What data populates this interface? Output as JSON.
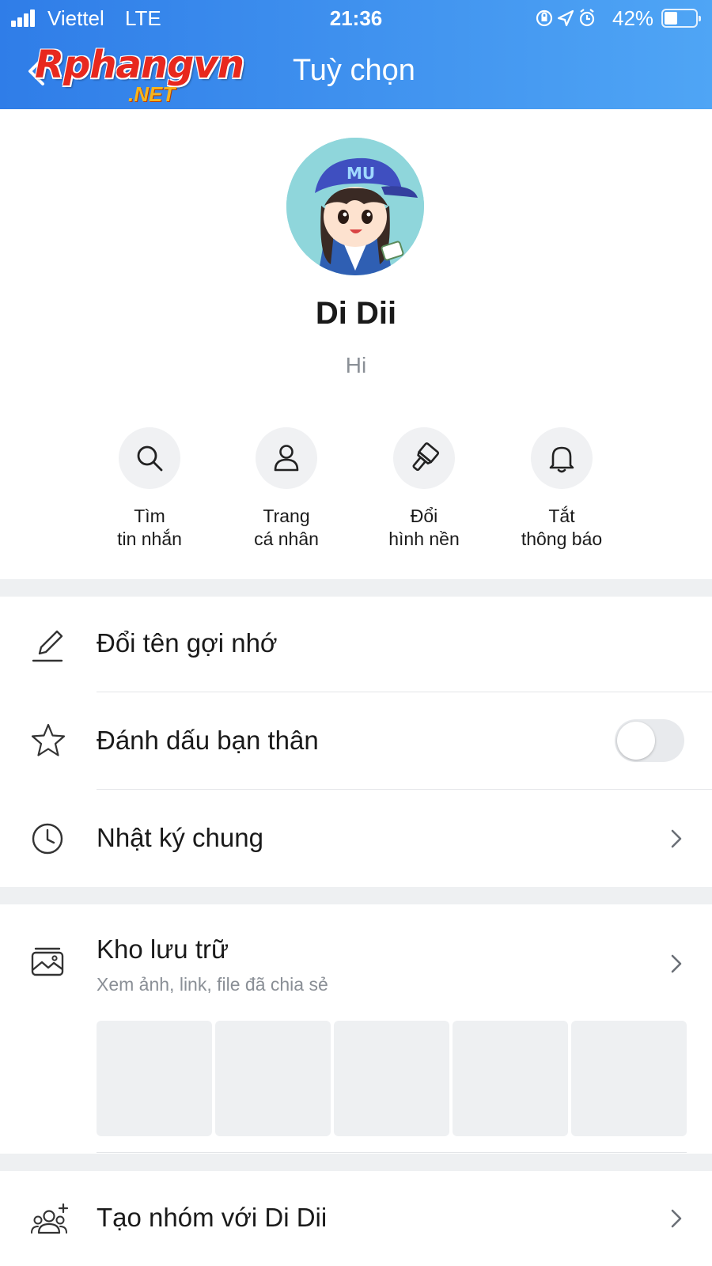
{
  "status_bar": {
    "carrier": "Viettel",
    "network": "LTE",
    "time": "21:36",
    "battery_percent": "42%",
    "battery_level": 0.42
  },
  "header": {
    "logo_text": "Rphangvn",
    "logo_suffix": ".NET",
    "title": "Tuỳ chọn"
  },
  "profile": {
    "name": "Di Dii",
    "status": "Hi"
  },
  "quick_actions": [
    {
      "icon": "search-icon",
      "line1": "Tìm",
      "line2": "tin nhắn"
    },
    {
      "icon": "person-icon",
      "line1": "Trang",
      "line2": "cá nhân"
    },
    {
      "icon": "paintbrush-icon",
      "line1": "Đổi",
      "line2": "hình nền"
    },
    {
      "icon": "bell-icon",
      "line1": "Tắt",
      "line2": "thông báo"
    }
  ],
  "options": {
    "rename": {
      "label": "Đổi tên gợi nhớ",
      "icon": "pencil-icon"
    },
    "best_friend": {
      "label": "Đánh dấu bạn thân",
      "icon": "star-icon",
      "toggle_on": false
    },
    "shared_timeline": {
      "label": "Nhật ký chung",
      "icon": "clock-icon"
    },
    "storage": {
      "label": "Kho lưu trữ",
      "sublabel": "Xem ảnh, link, file đã chia sẻ",
      "icon": "photo-folder-icon"
    },
    "create_group": {
      "label": "Tạo nhóm với Di Dii",
      "icon": "add-group-icon"
    }
  },
  "colors": {
    "header_start": "#2f7de8",
    "header_end": "#4fa5f5",
    "section_gap": "#eef0f2"
  }
}
